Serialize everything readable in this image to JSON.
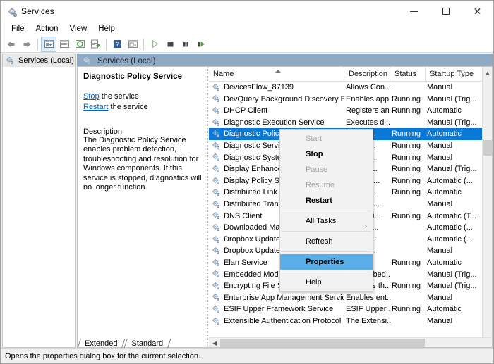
{
  "window": {
    "title": "Services",
    "icon": "services-gear-icon",
    "minimize_label": "Minimize",
    "maximize_label": "Maximize",
    "close_label": "Close"
  },
  "menubar": {
    "items": [
      {
        "label": "File",
        "name": "menu-file"
      },
      {
        "label": "Action",
        "name": "menu-action"
      },
      {
        "label": "View",
        "name": "menu-view"
      },
      {
        "label": "Help",
        "name": "menu-help"
      }
    ]
  },
  "toolbar": {
    "buttons": [
      {
        "name": "back-button",
        "icon": "arrow-left-icon",
        "title": "Back"
      },
      {
        "name": "forward-button",
        "icon": "arrow-right-icon",
        "title": "Forward"
      },
      {
        "name": "show-hide-console-tree-button",
        "icon": "console-tree-icon",
        "title": "Show/Hide Console Tree"
      },
      {
        "name": "show-hide-action-pane-button",
        "icon": "action-pane-icon",
        "title": "Show/Hide Action Pane"
      },
      {
        "name": "refresh-button",
        "icon": "refresh-icon",
        "title": "Refresh"
      },
      {
        "name": "export-list-button",
        "icon": "export-list-icon",
        "title": "Export List"
      },
      {
        "name": "help-button",
        "icon": "question-mark-icon",
        "title": "Help"
      },
      {
        "name": "properties-button",
        "icon": "properties-icon",
        "title": "Properties"
      },
      {
        "name": "start-service-button",
        "icon": "play-icon",
        "title": "Start Service"
      },
      {
        "name": "stop-service-button",
        "icon": "stop-icon",
        "title": "Stop Service"
      },
      {
        "name": "pause-service-button",
        "icon": "pause-icon",
        "title": "Pause Service"
      },
      {
        "name": "restart-service-button",
        "icon": "restart-icon",
        "title": "Restart Service"
      }
    ]
  },
  "left_pane": {
    "tree_root": "Services (Local)"
  },
  "right_pane": {
    "header": "Services (Local)"
  },
  "detail": {
    "title": "Diagnostic Policy Service",
    "stop_link": "Stop",
    "stop_suffix": " the service",
    "restart_link": "Restart",
    "restart_suffix": " the service",
    "description_label": "Description:",
    "description": "The Diagnostic Policy Service enables problem detection, troubleshooting and resolution for Windows components.  If this service is stopped, diagnostics will no longer function."
  },
  "list": {
    "columns": [
      "Name",
      "Description",
      "Status",
      "Startup Type"
    ],
    "sort_column": "Name",
    "sort_direction": "ascending",
    "rows": [
      {
        "name": "DevicesFlow_87139",
        "description": "Allows Con...",
        "status": "",
        "startup": "Manual",
        "selected": false
      },
      {
        "name": "DevQuery Background Discovery B...",
        "description": "Enables app...",
        "status": "Running",
        "startup": "Manual (Trig...",
        "selected": false
      },
      {
        "name": "DHCP Client",
        "description": "Registers an...",
        "status": "Running",
        "startup": "Automatic",
        "selected": false
      },
      {
        "name": "Diagnostic Execution Service",
        "description": "Executes di...",
        "status": "",
        "startup": "Manual (Trig...",
        "selected": false
      },
      {
        "name": "Diagnostic Policy Service",
        "description": "...agno...",
        "status": "Running",
        "startup": "Automatic",
        "selected": true
      },
      {
        "name": "Diagnostic Service Host",
        "description": "...agno...",
        "status": "Running",
        "startup": "Manual",
        "selected": false
      },
      {
        "name": "Diagnostic System Host",
        "description": "...agno...",
        "status": "Running",
        "startup": "Manual",
        "selected": false
      },
      {
        "name": "Display Enhancement Service",
        "description": "...ice fo...",
        "status": "Running",
        "startup": "Manual (Trig...",
        "selected": false
      },
      {
        "name": "Display Policy Service",
        "description": "...ges th...",
        "status": "Running",
        "startup": "Automatic (...",
        "selected": false
      },
      {
        "name": "Distributed Link Tracking Client",
        "description": "...ains li...",
        "status": "Running",
        "startup": "Automatic",
        "selected": false
      },
      {
        "name": "Distributed Transaction Coordinator",
        "description": "...inates...",
        "status": "",
        "startup": "Manual",
        "selected": false
      },
      {
        "name": "DNS Client",
        "description": "...NS Cli...",
        "status": "Running",
        "startup": "Automatic (T...",
        "selected": false
      },
      {
        "name": "Downloaded Maps Manager",
        "description": "...ws se...",
        "status": "",
        "startup": "Automatic (...",
        "selected": false
      },
      {
        "name": "Dropbox Update Service (dbupdate)",
        "description": "...your ...",
        "status": "",
        "startup": "Automatic (...",
        "selected": false
      },
      {
        "name": "Dropbox Update Service (dbupdatem)",
        "description": "...your ...",
        "status": "",
        "startup": "Manual",
        "selected": false
      },
      {
        "name": "Elan Service",
        "description": "",
        "status": "Running",
        "startup": "Automatic",
        "selected": false
      },
      {
        "name": "Embedded Mode",
        "description": "The Embed...",
        "status": "",
        "startup": "Manual (Trig...",
        "selected": false
      },
      {
        "name": "Encrypting File System (EFS)",
        "description": "Provides th...",
        "status": "Running",
        "startup": "Manual (Trig...",
        "selected": false
      },
      {
        "name": "Enterprise App Management Service",
        "description": "Enables ent...",
        "status": "",
        "startup": "Manual",
        "selected": false
      },
      {
        "name": "ESIF Upper Framework Service",
        "description": "ESIF Upper ...",
        "status": "Running",
        "startup": "Automatic",
        "selected": false
      },
      {
        "name": "Extensible Authentication Protocol",
        "description": "The Extensi...",
        "status": "",
        "startup": "Manual",
        "selected": false
      }
    ]
  },
  "context_menu": {
    "items": [
      {
        "label": "Start",
        "state": "disabled",
        "name": "ctx-start"
      },
      {
        "label": "Stop",
        "state": "bold",
        "name": "ctx-stop"
      },
      {
        "label": "Pause",
        "state": "disabled",
        "name": "ctx-pause"
      },
      {
        "label": "Resume",
        "state": "disabled",
        "name": "ctx-resume"
      },
      {
        "label": "Restart",
        "state": "bold",
        "name": "ctx-restart"
      },
      {
        "label": "All Tasks",
        "state": "submenu",
        "name": "ctx-all-tasks"
      },
      {
        "label": "Refresh",
        "state": "normal",
        "name": "ctx-refresh"
      },
      {
        "label": "Properties",
        "state": "highlight",
        "name": "ctx-properties"
      },
      {
        "label": "Help",
        "state": "normal",
        "name": "ctx-help"
      }
    ],
    "submenu_arrow": "›"
  },
  "tabs": [
    {
      "label": "Extended",
      "active": false,
      "name": "tab-extended"
    },
    {
      "label": "Standard",
      "active": true,
      "name": "tab-standard"
    }
  ],
  "statusbar": {
    "text": "Opens the properties dialog box for the current selection."
  },
  "colors": {
    "selection_blue": "#0a78d7",
    "header_blue": "#8faac4",
    "link_blue": "#0066cc",
    "menu_highlight": "#5aafe8"
  }
}
